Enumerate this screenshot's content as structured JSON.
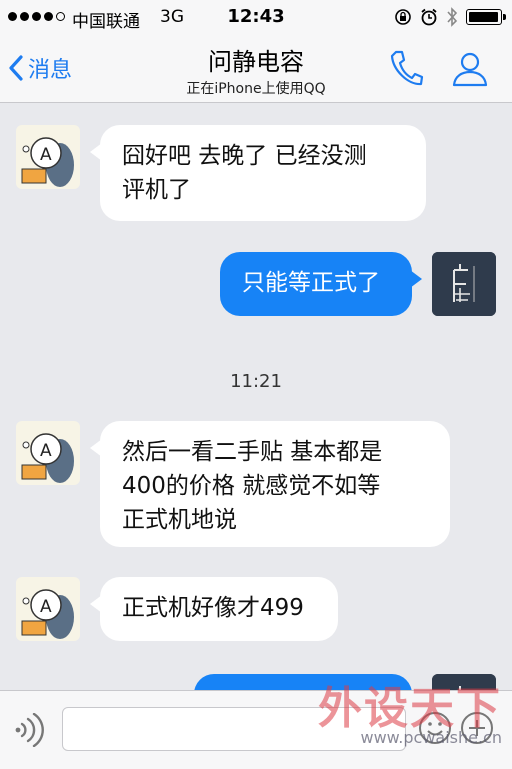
{
  "status_bar": {
    "carrier": "中国联通",
    "network": "3G",
    "time": "12:43"
  },
  "nav": {
    "back_label": "消息",
    "title": "问静电容",
    "subtitle": "正在iPhone上使用QQ"
  },
  "messages": [
    {
      "direction": "in",
      "text": "囧好吧  去晚了  已经没测\n评机了"
    },
    {
      "direction": "out",
      "text": "只能等正式了"
    },
    {
      "direction": "in",
      "text": "然后一看二手贴  基本都是\n400的价格 就感觉不如等\n正式机地说"
    },
    {
      "direction": "in",
      "text": "正式机好像才499"
    },
    {
      "direction": "out",
      "text": ""
    }
  ],
  "timestamp": "11:21",
  "input": {
    "value": "",
    "placeholder": ""
  },
  "watermark": {
    "brand": "外设天下",
    "url": "www.pcwaishe.cn"
  },
  "colors": {
    "accent": "#1e7cf0",
    "bubble_out": "#1783f6",
    "bubble_in": "#ffffff",
    "background": "#e8e9ed"
  },
  "icons": [
    "chevron-left-icon",
    "phone-icon",
    "profile-icon",
    "voice-icon",
    "emoji-icon",
    "plus-icon",
    "alarm-icon",
    "bluetooth-icon",
    "battery-icon",
    "rotation-lock-icon"
  ]
}
